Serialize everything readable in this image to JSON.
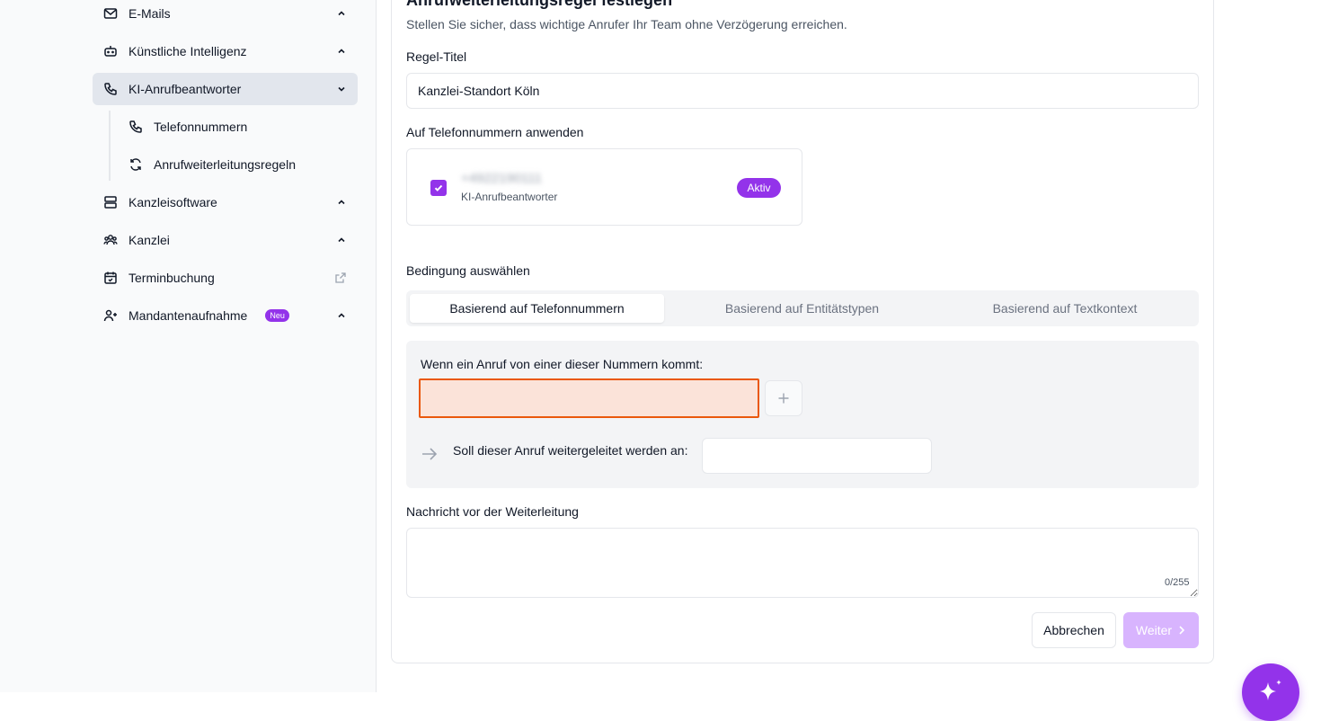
{
  "sidebar": {
    "items": [
      {
        "label": "E-Mails",
        "icon": "mail-icon"
      },
      {
        "label": "Künstliche Intelligenz",
        "icon": "bot-icon"
      },
      {
        "label": "KI-Anrufbeantworter",
        "icon": "phone-icon"
      },
      {
        "label": "Kanzleisoftware",
        "icon": "server-icon"
      },
      {
        "label": "Kanzlei",
        "icon": "users-icon"
      },
      {
        "label": "Terminbuchung",
        "icon": "calendar-icon"
      },
      {
        "label": "Mandantenaufnahme",
        "icon": "user-plus-icon",
        "badge": "Neu"
      }
    ],
    "sub_items": [
      {
        "label": "Telefonnummern",
        "icon": "phone-icon"
      },
      {
        "label": "Anrufweiterleitungsregeln",
        "icon": "refresh-icon"
      }
    ]
  },
  "form": {
    "title": "Anrufweiterleitungsregel festlegen",
    "subtitle": "Stellen Sie sicher, dass wichtige Anrufer Ihr Team ohne Verzögerung erreichen.",
    "rule_title_label": "Regel-Titel",
    "rule_title_value": "Kanzlei-Standort Köln",
    "apply_label": "Auf Telefonnummern anwenden",
    "phone": {
      "number": "+4922190111",
      "subtitle": "KI-Anrufbeantworter",
      "status": "Aktiv"
    },
    "condition_label": "Bedingung auswählen",
    "tabs": [
      "Basierend auf Telefonnummern",
      "Basierend auf Entitätstypen",
      "Basierend auf Textkontext"
    ],
    "condition_text": "Wenn ein Anruf von einer dieser Nummern kommt:",
    "forward_text": "Soll dieser Anruf weitergeleitet werden an:",
    "message_label": "Nachricht vor der Weiterleitung",
    "counter": "0/255",
    "cancel_label": "Abbrechen",
    "next_label": "Weiter"
  },
  "colors": {
    "accent": "#9333ea",
    "error_border": "#ea580c",
    "error_bg": "#fbe3d9"
  }
}
